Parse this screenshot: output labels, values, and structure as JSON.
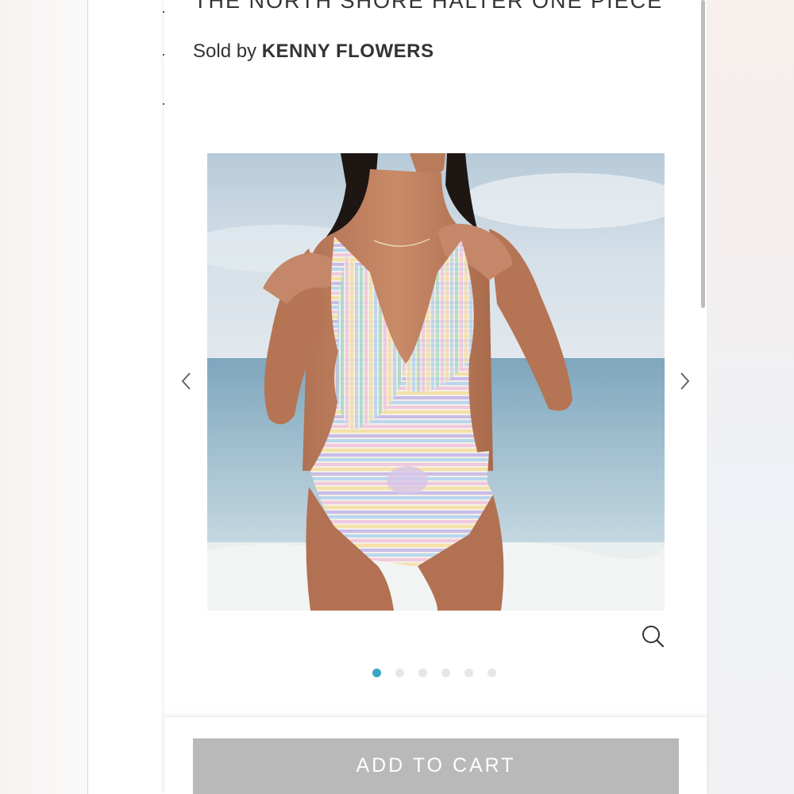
{
  "product": {
    "title": "THE NORTH SHORE HALTER ONE PIECE",
    "sold_by_prefix": "Sold by ",
    "seller": "KENNY FLOWERS"
  },
  "gallery": {
    "image_alt": "Model wearing pastel striped halter one piece swimsuit on beach",
    "prev_icon": "chevron-left-icon",
    "next_icon": "chevron-right-icon",
    "zoom_icon": "search-zoom-icon",
    "slide_count": 6,
    "active_slide": 1
  },
  "cart": {
    "add_label": "ADD TO CART"
  },
  "colors": {
    "accent_dot": "#3aa6c2",
    "inactive_dot": "#e6e6e6",
    "button_bg": "#b9b9b9",
    "button_text": "#ffffff",
    "text": "#333333"
  }
}
